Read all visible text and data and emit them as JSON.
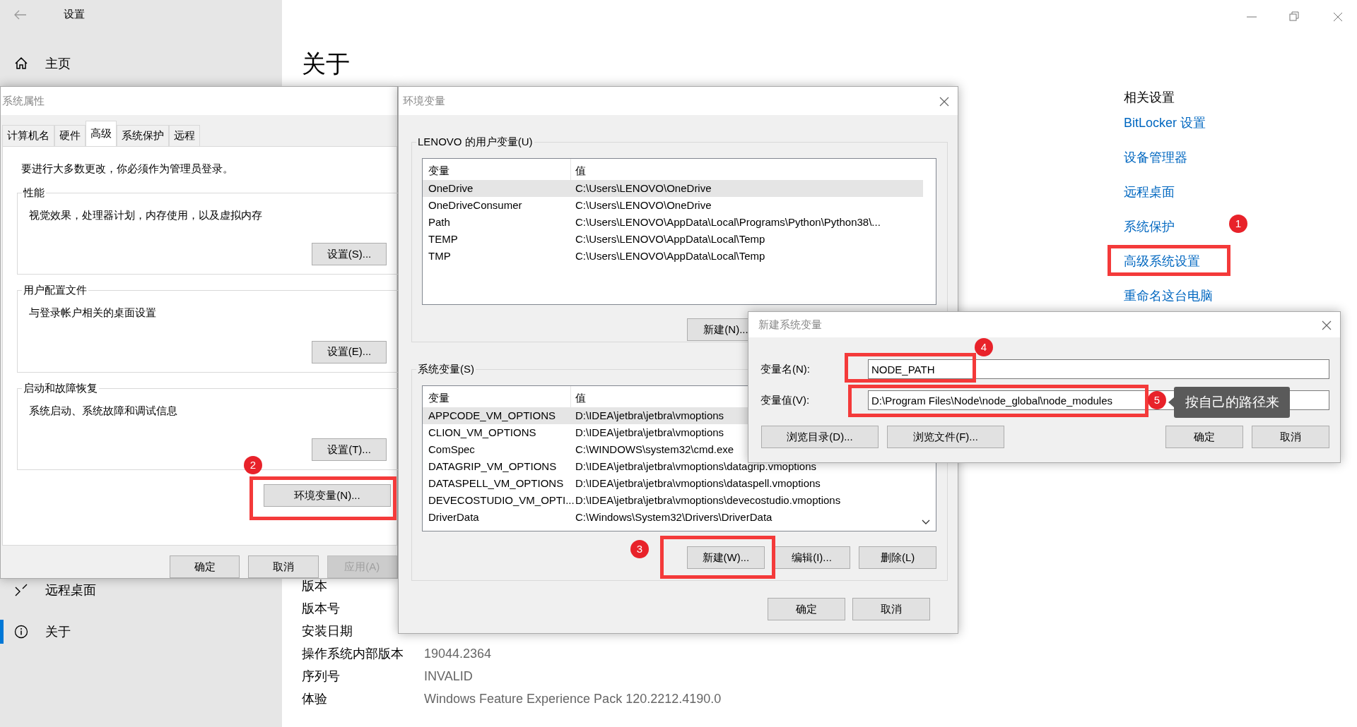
{
  "settings": {
    "title": "设置",
    "nav": [
      {
        "label": "主页",
        "kind": "home",
        "selected": false
      },
      {
        "label": "远程桌面",
        "kind": "remote",
        "selected": false
      },
      {
        "label": "关于",
        "kind": "about",
        "selected": true
      }
    ],
    "heading": "关于",
    "about_rows": [
      {
        "label": "版本"
      },
      {
        "label": "版本号"
      },
      {
        "label": "安装日期"
      },
      {
        "label": "操作系统内部版本",
        "value": "19044.2364"
      },
      {
        "label": "序列号",
        "value": "INVALID"
      },
      {
        "label": "体验",
        "value": "Windows Feature Experience Pack 120.2212.4190.0"
      }
    ],
    "related": {
      "title": "相关设置",
      "links": [
        "BitLocker 设置",
        "设备管理器",
        "远程桌面",
        "系统保护",
        "高级系统设置",
        "重命名这台电脑"
      ]
    }
  },
  "system_properties": {
    "title": "系统属性",
    "tabs": [
      {
        "label": "计算机名",
        "selected": false
      },
      {
        "label": "硬件",
        "selected": false
      },
      {
        "label": "高级",
        "selected": true
      },
      {
        "label": "系统保护",
        "selected": false
      },
      {
        "label": "远程",
        "selected": false
      }
    ],
    "notice": "要进行大多数更改，你必须作为管理员登录。",
    "groups": [
      {
        "title": "性能",
        "description": "视觉效果，处理器计划，内存使用，以及虚拟内存",
        "button": "设置(S)..."
      },
      {
        "title": "用户配置文件",
        "description": "与登录帐户相关的桌面设置",
        "button": "设置(E)..."
      },
      {
        "title": "启动和故障恢复",
        "description": "系统启动、系统故障和调试信息",
        "button": "设置(T)..."
      }
    ],
    "env_button": "环境变量(N)...",
    "buttons": [
      {
        "label": "确定",
        "disabled": false
      },
      {
        "label": "取消",
        "disabled": false
      },
      {
        "label": "应用(A)",
        "disabled": true
      }
    ]
  },
  "environment_variables": {
    "title": "环境变量",
    "user_group": {
      "title": "LENOVO 的用户变量(U)",
      "columns": [
        "变量",
        "值"
      ],
      "rows": [
        {
          "name": "OneDrive",
          "value": "C:\\Users\\LENOVO\\OneDrive",
          "selected": true
        },
        {
          "name": "OneDriveConsumer",
          "value": "C:\\Users\\LENOVO\\OneDrive",
          "selected": false
        },
        {
          "name": "Path",
          "value": "C:\\Users\\LENOVO\\AppData\\Local\\Programs\\Python\\Python38\\...",
          "selected": false
        },
        {
          "name": "TEMP",
          "value": "C:\\Users\\LENOVO\\AppData\\Local\\Temp",
          "selected": false
        },
        {
          "name": "TMP",
          "value": "C:\\Users\\LENOVO\\AppData\\Local\\Temp",
          "selected": false
        }
      ],
      "buttons": [
        "新建(N)..."
      ]
    },
    "system_group": {
      "title": "系统变量(S)",
      "columns": [
        "变量",
        "值"
      ],
      "rows": [
        {
          "name": "APPCODE_VM_OPTIONS",
          "value": "D:\\IDEA\\jetbra\\jetbra\\vmoptions",
          "selected": true
        },
        {
          "name": "CLION_VM_OPTIONS",
          "value": "D:\\IDEA\\jetbra\\jetbra\\vmoptions",
          "selected": false
        },
        {
          "name": "ComSpec",
          "value": "C:\\WINDOWS\\system32\\cmd.exe",
          "selected": false
        },
        {
          "name": "DATAGRIP_VM_OPTIONS",
          "value": "D:\\IDEA\\jetbra\\jetbra\\vmoptions\\datagrip.vmoptions",
          "selected": false
        },
        {
          "name": "DATASPELL_VM_OPTIONS",
          "value": "D:\\IDEA\\jetbra\\jetbra\\vmoptions\\dataspell.vmoptions",
          "selected": false
        },
        {
          "name": "DEVECOSTUDIO_VM_OPTI...",
          "value": "D:\\IDEA\\jetbra\\jetbra\\vmoptions\\devecostudio.vmoptions",
          "selected": false
        },
        {
          "name": "DriverData",
          "value": "C:\\Windows\\System32\\Drivers\\DriverData",
          "selected": false
        }
      ],
      "buttons": [
        "新建(W)...",
        "编辑(I)...",
        "删除(L)"
      ]
    },
    "buttons": [
      "确定",
      "取消"
    ]
  },
  "new_variable": {
    "title": "新建系统变量",
    "fields": [
      {
        "label": "变量名(N):",
        "value": "NODE_PATH"
      },
      {
        "label": "变量值(V):",
        "value": "D:\\Program Files\\Node\\node_global\\node_modules"
      }
    ],
    "buttons": [
      "浏览目录(D)...",
      "浏览文件(F)...",
      "确定",
      "取消"
    ],
    "tooltip": "按自己的路径来"
  },
  "annotations": [
    {
      "label": "1"
    },
    {
      "label": "2"
    },
    {
      "label": "3"
    },
    {
      "label": "4"
    },
    {
      "label": "5"
    }
  ]
}
